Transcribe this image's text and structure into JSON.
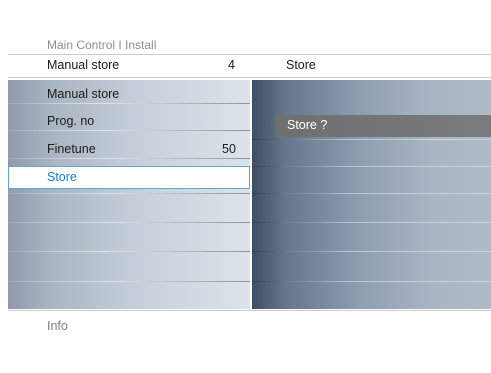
{
  "breadcrumb": "Main Control I Install",
  "header": {
    "label": "Manual store",
    "value": "4",
    "right_title": "Store"
  },
  "menu": {
    "items": [
      {
        "label": "Manual store",
        "value": ""
      },
      {
        "label": "Prog. no",
        "value": ""
      },
      {
        "label": "Finetune",
        "value": "50"
      },
      {
        "label": "Store",
        "value": ""
      }
    ],
    "selected_index": 3
  },
  "right_panel": {
    "option": "Store ?"
  },
  "footer": {
    "info": "Info"
  },
  "colors": {
    "selected_text": "#1f7bc4",
    "selected_border": "#5fa5d6",
    "option_bg": "#727274"
  }
}
